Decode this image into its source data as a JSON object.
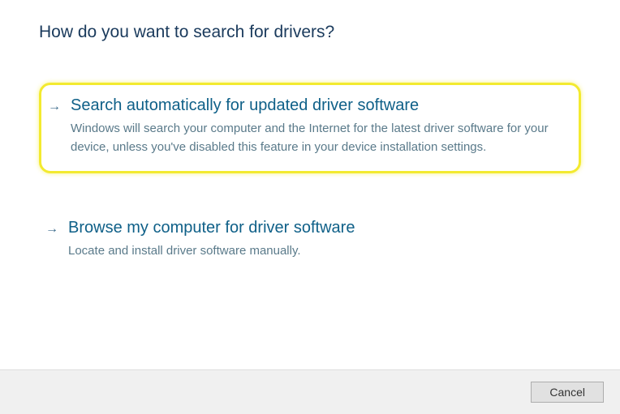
{
  "heading": "How do you want to search for drivers?",
  "options": [
    {
      "title": "Search automatically for updated driver software",
      "description": "Windows will search your computer and the Internet for the latest driver software for your device, unless you've disabled this feature in your device installation settings.",
      "highlighted": true
    },
    {
      "title": "Browse my computer for driver software",
      "description": "Locate and install driver software manually.",
      "highlighted": false
    }
  ],
  "footer": {
    "cancel_label": "Cancel"
  }
}
